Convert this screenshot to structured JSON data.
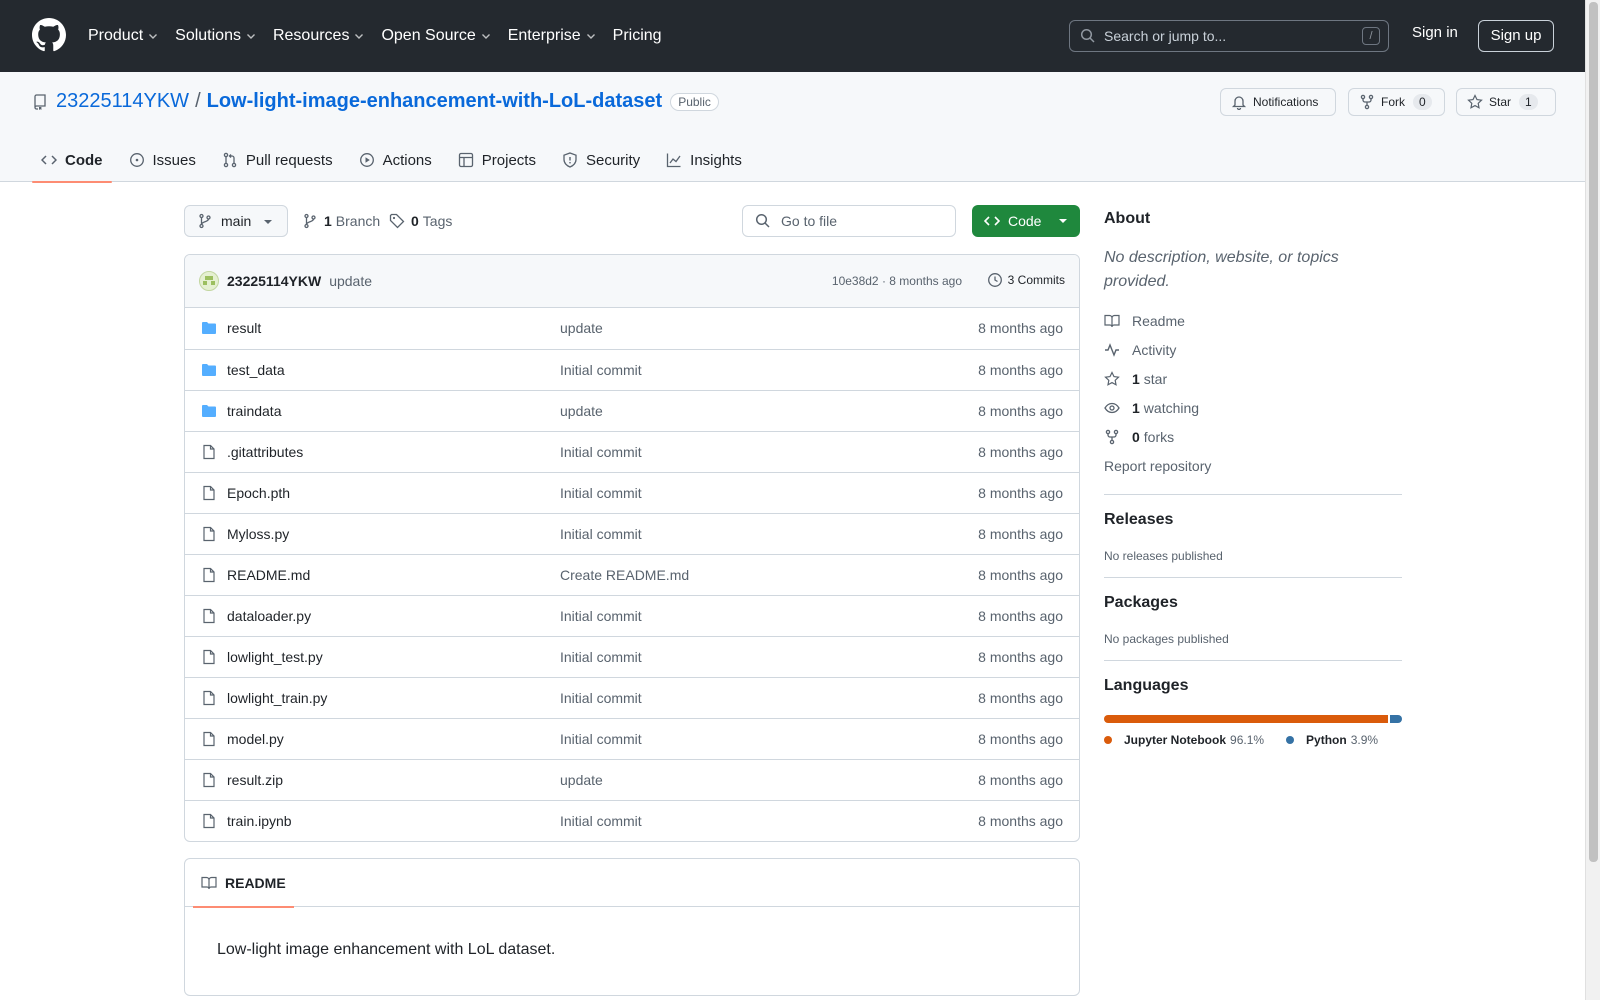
{
  "header": {
    "nav": [
      {
        "label": "Product",
        "dropdown": true
      },
      {
        "label": "Solutions",
        "dropdown": true
      },
      {
        "label": "Resources",
        "dropdown": true
      },
      {
        "label": "Open Source",
        "dropdown": true
      },
      {
        "label": "Enterprise",
        "dropdown": true
      },
      {
        "label": "Pricing",
        "dropdown": false
      }
    ],
    "search_placeholder": "Search or jump to...",
    "search_shortcut": "/",
    "signin": "Sign in",
    "signup": "Sign up"
  },
  "repo": {
    "owner": "23225114YKW",
    "separator": "/",
    "name": "Low-light-image-enhancement-with-LoL-dataset",
    "visibility": "Public",
    "notifications_label": "Notifications",
    "fork_label": "Fork",
    "fork_count": "0",
    "star_label": "Star",
    "star_count": "1",
    "tabs": [
      {
        "label": "Code",
        "icon": "code-icon",
        "active": true
      },
      {
        "label": "Issues",
        "icon": "issue-icon",
        "active": false
      },
      {
        "label": "Pull requests",
        "icon": "pull-request-icon",
        "active": false
      },
      {
        "label": "Actions",
        "icon": "play-icon",
        "active": false
      },
      {
        "label": "Projects",
        "icon": "table-icon",
        "active": false
      },
      {
        "label": "Security",
        "icon": "shield-icon",
        "active": false
      },
      {
        "label": "Insights",
        "icon": "graph-icon",
        "active": false
      }
    ]
  },
  "toolbar": {
    "branch": "main",
    "branch_count": "1",
    "branch_label": "Branch",
    "tag_count": "0",
    "tag_label": "Tags",
    "goto_placeholder": "Go to file",
    "code_button": "Code"
  },
  "commit": {
    "author": "23225114YKW",
    "message": "update",
    "sha_time": "10e38d2 · 8 months ago",
    "commits_label": "3 Commits"
  },
  "files": [
    {
      "name": "result",
      "type": "dir",
      "message": "update",
      "time": "8 months ago"
    },
    {
      "name": "test_data",
      "type": "dir",
      "message": "Initial commit",
      "time": "8 months ago"
    },
    {
      "name": "traindata",
      "type": "dir",
      "message": "update",
      "time": "8 months ago"
    },
    {
      "name": ".gitattributes",
      "type": "file",
      "message": "Initial commit",
      "time": "8 months ago"
    },
    {
      "name": "Epoch.pth",
      "type": "file",
      "message": "Initial commit",
      "time": "8 months ago"
    },
    {
      "name": "Myloss.py",
      "type": "file",
      "message": "Initial commit",
      "time": "8 months ago"
    },
    {
      "name": "README.md",
      "type": "file",
      "message": "Create README.md",
      "time": "8 months ago"
    },
    {
      "name": "dataloader.py",
      "type": "file",
      "message": "Initial commit",
      "time": "8 months ago"
    },
    {
      "name": "lowlight_test.py",
      "type": "file",
      "message": "Initial commit",
      "time": "8 months ago"
    },
    {
      "name": "lowlight_train.py",
      "type": "file",
      "message": "Initial commit",
      "time": "8 months ago"
    },
    {
      "name": "model.py",
      "type": "file",
      "message": "Initial commit",
      "time": "8 months ago"
    },
    {
      "name": "result.zip",
      "type": "file",
      "message": "update",
      "time": "8 months ago"
    },
    {
      "name": "train.ipynb",
      "type": "file",
      "message": "Initial commit",
      "time": "8 months ago"
    }
  ],
  "readme": {
    "tab_label": "README",
    "body": "Low-light image enhancement with LoL dataset."
  },
  "about": {
    "title": "About",
    "description": "No description, website, or topics provided.",
    "readme": "Readme",
    "activity": "Activity",
    "stars_count": "1",
    "stars_label": "star",
    "watching_count": "1",
    "watching_label": "watching",
    "forks_count": "0",
    "forks_label": "forks",
    "report": "Report repository"
  },
  "releases": {
    "title": "Releases",
    "text": "No releases published"
  },
  "packages": {
    "title": "Packages",
    "text": "No packages published"
  },
  "languages": {
    "title": "Languages",
    "items": [
      {
        "name": "Jupyter Notebook",
        "percent": "96.1%",
        "value": 96.1,
        "color": "#DA5B0B"
      },
      {
        "name": "Python",
        "percent": "3.9%",
        "value": 3.9,
        "color": "#3572A5"
      }
    ]
  }
}
